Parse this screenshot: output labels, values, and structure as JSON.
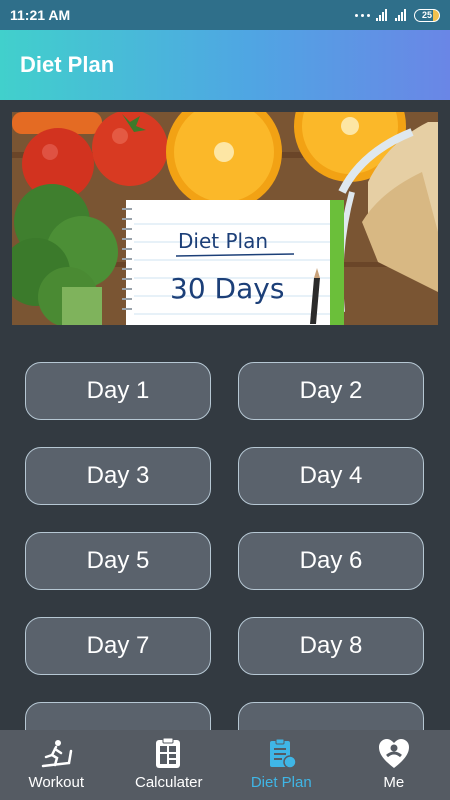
{
  "status_bar": {
    "time": "11:21 AM",
    "battery": "25"
  },
  "header": {
    "title": "Diet Plan"
  },
  "banner": {
    "line1": "Diet Plan",
    "line2": "30 Days"
  },
  "days": [
    {
      "label": "Day 1"
    },
    {
      "label": "Day 2"
    },
    {
      "label": "Day 3"
    },
    {
      "label": "Day 4"
    },
    {
      "label": "Day 5"
    },
    {
      "label": "Day 6"
    },
    {
      "label": "Day 7"
    },
    {
      "label": "Day 8"
    },
    {
      "label": ""
    },
    {
      "label": ""
    }
  ],
  "nav": {
    "items": [
      {
        "label": "Workout",
        "icon": "treadmill-icon"
      },
      {
        "label": "Calculater",
        "icon": "calculator-icon"
      },
      {
        "label": "Diet Plan",
        "icon": "diet-plan-icon",
        "active": true
      },
      {
        "label": "Me",
        "icon": "profile-heart-icon"
      }
    ],
    "active_color": "#3fb6e6"
  },
  "colors": {
    "app_bar_start": "#41d0cc",
    "app_bar_end": "#6a86e6",
    "background": "#333a41",
    "button": "#5a626c",
    "nav": "#555b63"
  }
}
